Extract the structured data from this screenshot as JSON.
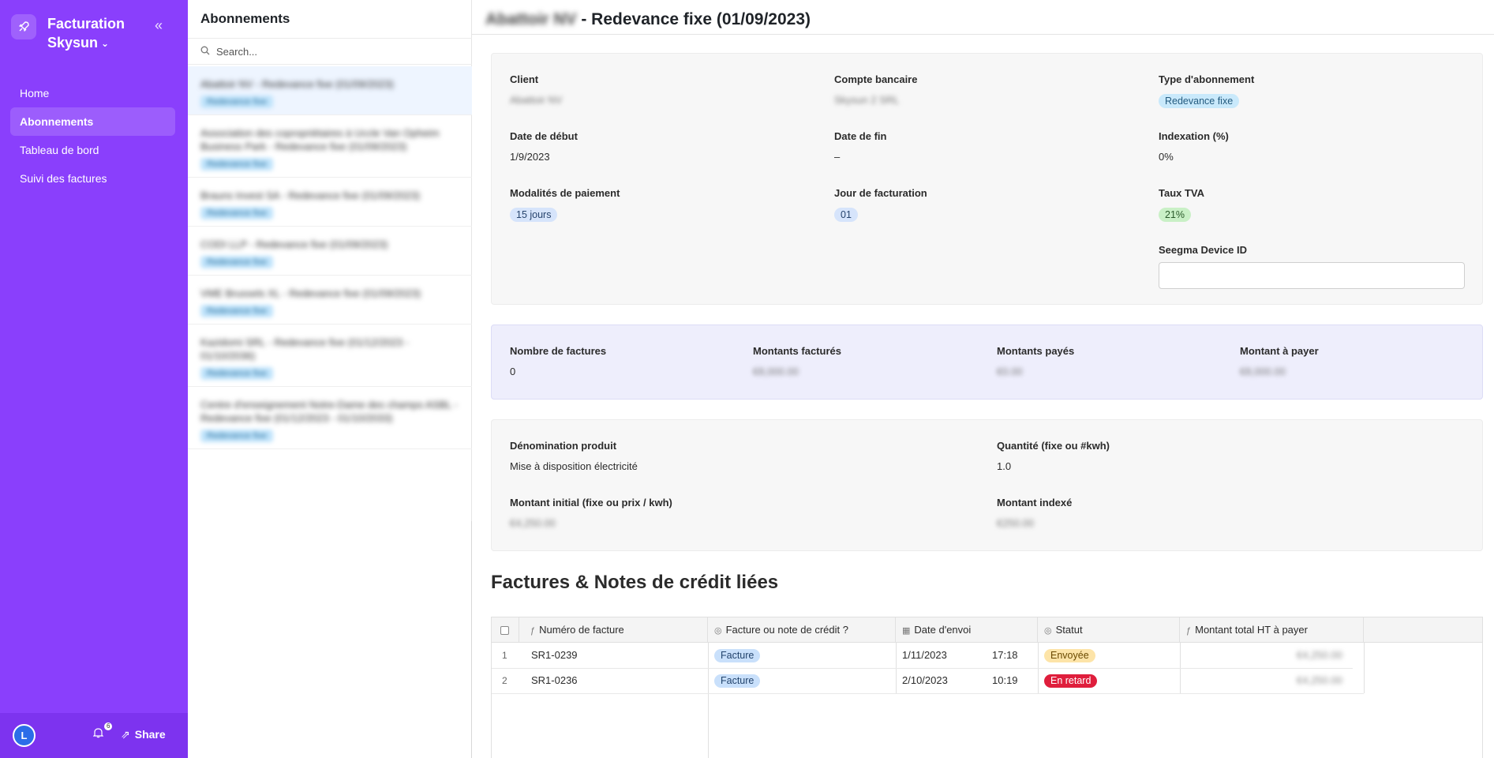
{
  "app": {
    "title_line1": "Facturation",
    "title_line2": "Skysun"
  },
  "sidebar": {
    "items": [
      {
        "label": "Home"
      },
      {
        "label": "Abonnements"
      },
      {
        "label": "Tableau de bord"
      },
      {
        "label": "Suivi des factures"
      }
    ],
    "footer": {
      "avatar_initial": "L",
      "notification_count": "6",
      "share_label": "Share"
    }
  },
  "list": {
    "title": "Abonnements",
    "search_placeholder": "Search...",
    "items": [
      {
        "title": "Abattoir NV - Redevance fixe (01/09/2023)",
        "tag": "Redevance fixe"
      },
      {
        "title": "Association des copropriétaires à Uccle Van Opheim Business Park - Redevance fixe (01/09/2023)",
        "tag": "Redevance fixe"
      },
      {
        "title": "Brauns Invest SA - Redevance fixe (01/09/2023)",
        "tag": "Redevance fixe"
      },
      {
        "title": "CODI LLP - Redevance fixe (01/09/2023)",
        "tag": "Redevance fixe"
      },
      {
        "title": "VME Brussels XL - Redevance fixe (01/09/2023)",
        "tag": "Redevance fixe"
      },
      {
        "title": "Kazidomi SRL - Redevance fixe (01/12/2023 - 01/10/2036)",
        "tag": "Redevance fixe"
      },
      {
        "title": "Centre d'enseignement Notre-Dame des champs ASBL - Redevance fixe (01/12/2023 - 01/10/2033)",
        "tag": "Redevance fixe"
      }
    ]
  },
  "detail": {
    "title_client": "Abattoir NV",
    "title_rest": " - Redevance fixe (01/09/2023)",
    "client_label": "Client",
    "client_value": "Abattoir NV",
    "bank_label": "Compte bancaire",
    "bank_value": "Skysun 2 SRL",
    "type_label": "Type d'abonnement",
    "type_value": "Redevance fixe",
    "start_label": "Date de début",
    "start_value": "1/9/2023",
    "end_label": "Date de fin",
    "end_value": "–",
    "index_label": "Indexation (%)",
    "index_value": "0%",
    "payment_label": "Modalités de paiement",
    "payment_value": "15 jours",
    "billing_day_label": "Jour de facturation",
    "billing_day_value": "01",
    "vat_label": "Taux TVA",
    "vat_value": "21%",
    "device_label": "Seegma Device ID",
    "device_value": ""
  },
  "stats": {
    "count_label": "Nombre de factures",
    "count_value": "0",
    "billed_label": "Montants facturés",
    "billed_value": "€8,000.00",
    "paid_label": "Montants payés",
    "paid_value": "€0.00",
    "due_label": "Montant à payer",
    "due_value": "€8,000.00"
  },
  "product": {
    "name_label": "Dénomination produit",
    "name_value": "Mise à disposition électricité",
    "qty_label": "Quantité (fixe ou #kwh)",
    "qty_value": "1.0",
    "initial_label": "Montant initial (fixe ou prix / kwh)",
    "initial_value": "€4,250.00",
    "indexed_label": "Montant indexé",
    "indexed_value": "€250.00"
  },
  "invoices": {
    "section_title": "Factures & Notes de crédit liées",
    "columns": [
      "Numéro de facture",
      "Facture ou note de crédit ?",
      "Date d'envoi",
      "Statut",
      "Montant total HT à payer"
    ],
    "rows": [
      {
        "index": "1",
        "number": "SR1-0239",
        "kind": "Facture",
        "date": "1/11/2023",
        "time": "17:18",
        "status": "Envoyée",
        "status_color": "#fde4a8",
        "amount": "€4,250.00"
      },
      {
        "index": "2",
        "number": "SR1-0236",
        "kind": "Facture",
        "date": "2/10/2023",
        "time": "10:19",
        "status": "En retard",
        "status_color": "#df1e3c",
        "amount": "€4,250.00"
      }
    ]
  },
  "colors": {
    "sidebar": "#8a3ffc",
    "selected_item": "#eef5ff",
    "stats_card": "#eeeefc"
  }
}
